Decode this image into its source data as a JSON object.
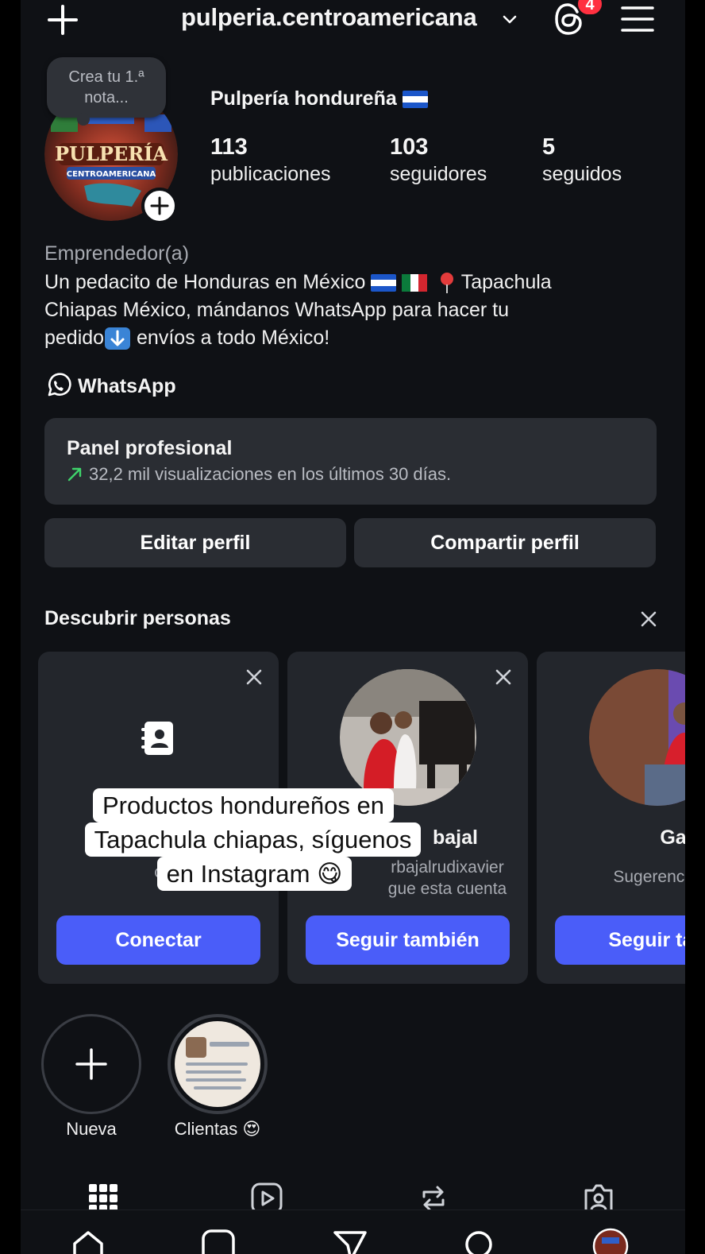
{
  "topbar": {
    "username": "pulperia.centroamericana",
    "threads_badge": "4"
  },
  "profile": {
    "note_placeholder": "Crea tu 1.ª nota...",
    "avatar_text": "PULPERÍA",
    "avatar_subtext": "CENTROAMERICANA",
    "display_name": "Pulpería hondureña",
    "stats": [
      {
        "value": "113",
        "label": "publicaciones"
      },
      {
        "value": "103",
        "label": "seguidores"
      },
      {
        "value": "5",
        "label": "seguidos"
      }
    ],
    "category": "Emprendedor(a)",
    "bio_line1": "Un pedacito de Honduras en México",
    "bio_loc": "Tapachula",
    "bio_line2": "Chiapas México, mándanos WhatsApp para hacer tu",
    "bio_line3_a": "pedido",
    "bio_line3_b": "envíos a todo México!",
    "whatsapp_label": "WhatsApp"
  },
  "panel": {
    "title": "Panel profesional",
    "subtitle": "32,2 mil visualizaciones en los últimos 30 días."
  },
  "buttons": {
    "edit": "Editar perfil",
    "share": "Compartir perfil"
  },
  "discover": {
    "title": "Descubrir personas",
    "cards": [
      {
        "name": "",
        "sub": "c",
        "button": "Conectar"
      },
      {
        "name": "bajal",
        "sub1": "rbajalrudixavier",
        "sub2": "gue esta cuenta",
        "button": "Seguir también"
      },
      {
        "name": "Ga Avil",
        "sub1": "Sugerencia",
        "button": "Seguir tan"
      }
    ]
  },
  "caption": {
    "line1": "Productos hondureños en",
    "line2": "Tapachula chiapas, síguenos",
    "line3": "en Instagram 😋"
  },
  "highlights": [
    {
      "label": "Nueva"
    },
    {
      "label": "Clientas 😍"
    }
  ],
  "colors": {
    "background": "#0f1115",
    "surface": "#2a2d33",
    "card": "#23262c",
    "accent": "#4a5df9",
    "badge": "#ff3040",
    "trend": "#3fd36b"
  }
}
